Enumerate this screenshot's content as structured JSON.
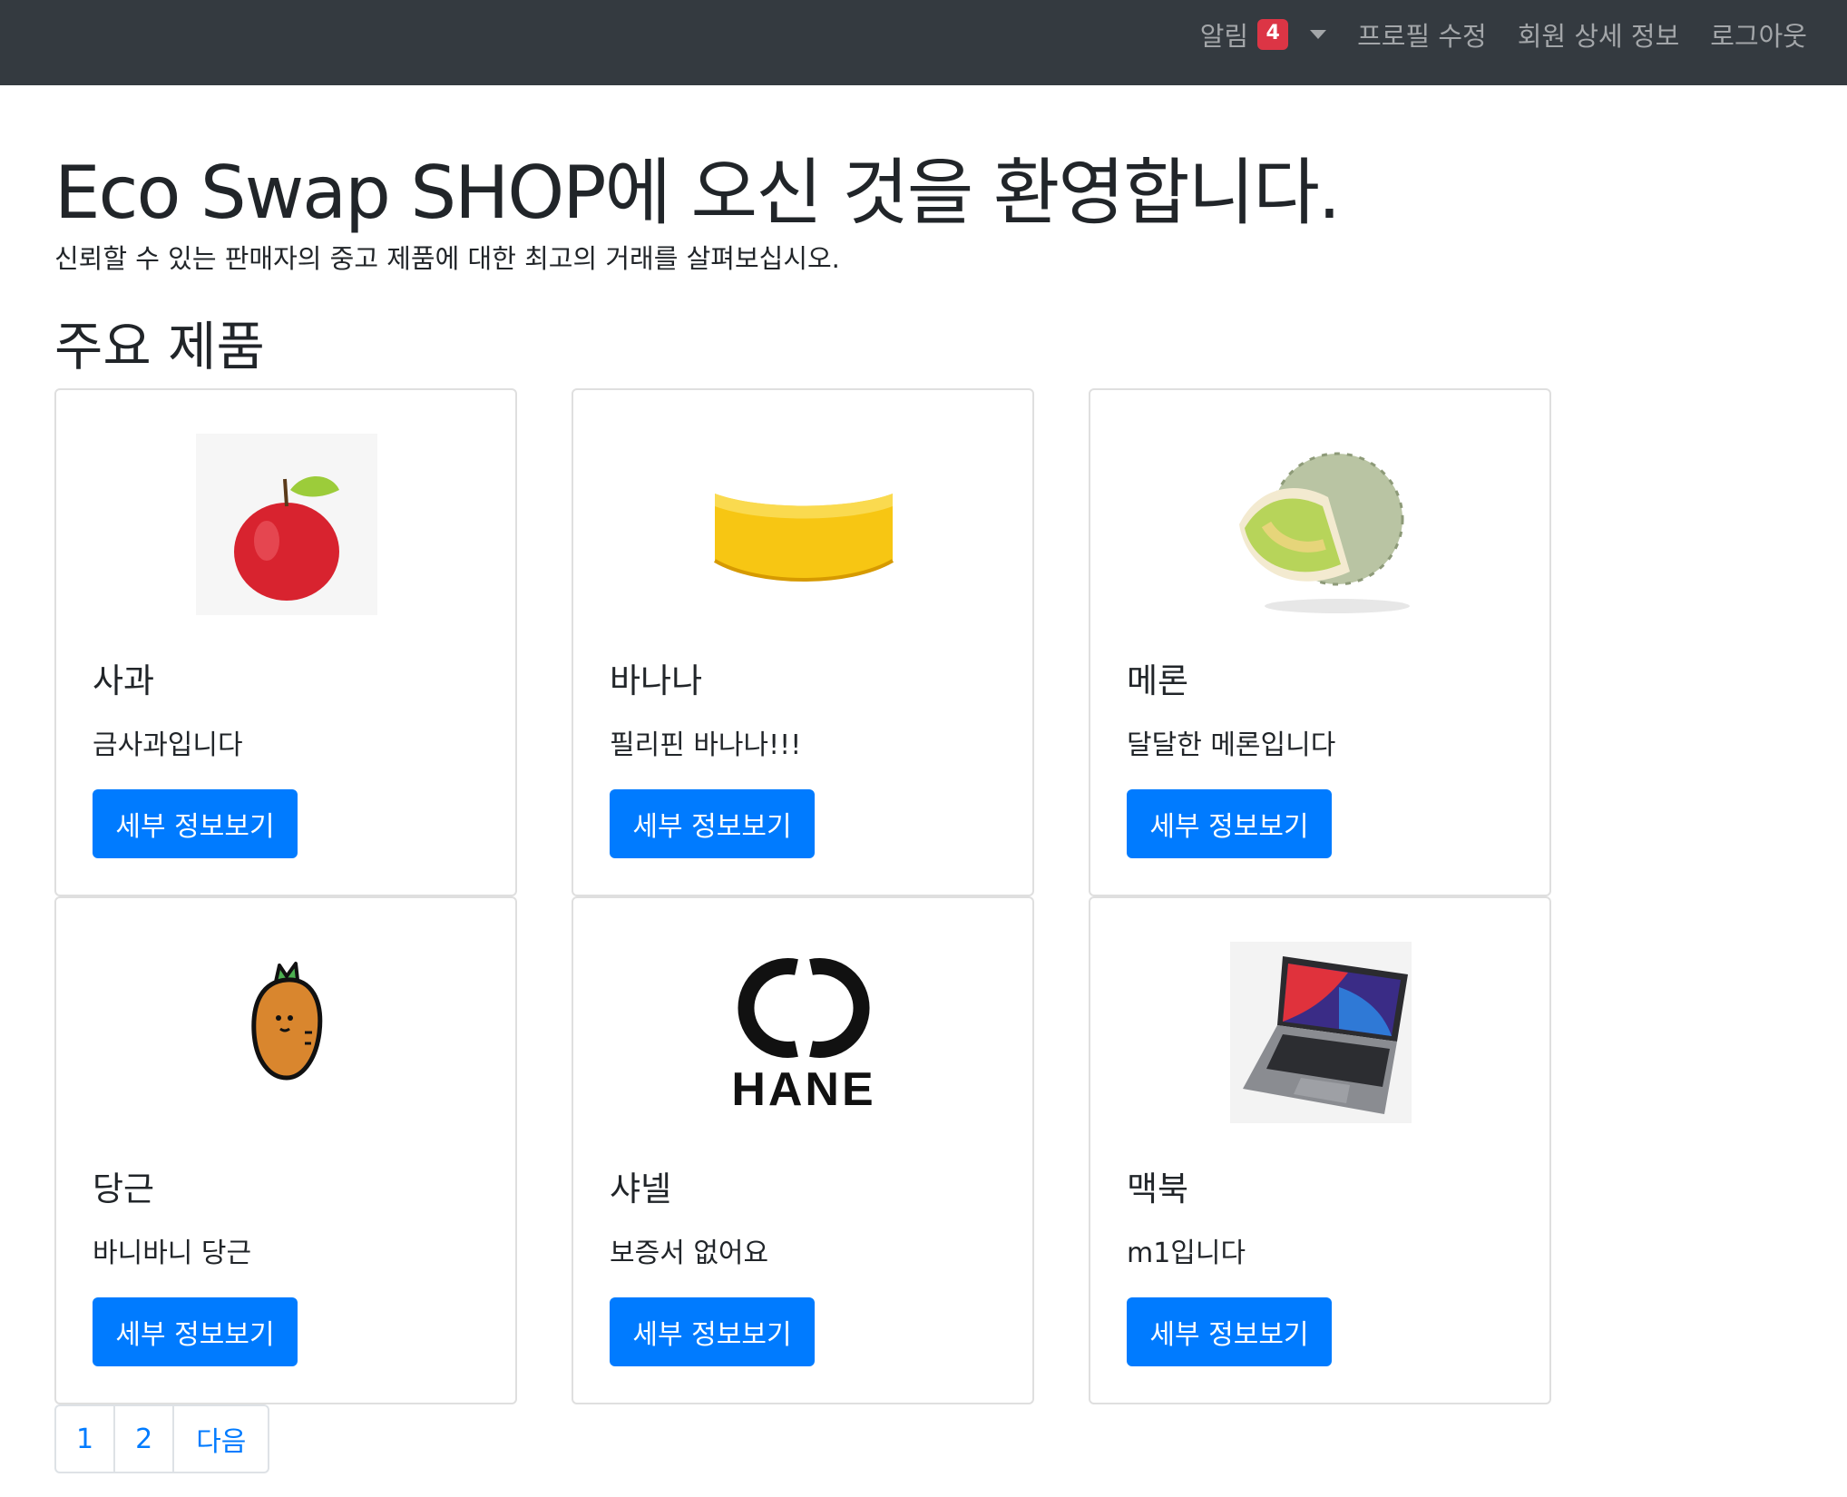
{
  "nav": {
    "alerts_label": "알림",
    "alerts_count": "4",
    "profile_edit": "프로필 수정",
    "member_details": "회원 상세 정보",
    "logout": "로그아웃"
  },
  "hero": {
    "title": "Eco Swap SHOP에 오신 것을 환영합니다.",
    "subtitle": "신뢰할 수 있는 판매자의 중고 제품에 대한 최고의 거래를 살펴보십시오."
  },
  "section": {
    "title": "주요 제품"
  },
  "products": [
    {
      "name": "사과",
      "description": "금사과입니다",
      "button": "세부 정보보기",
      "image_icon": "apple-icon"
    },
    {
      "name": "바나나",
      "description": "필리핀 바나나!!!",
      "button": "세부 정보보기",
      "image_icon": "banana-icon"
    },
    {
      "name": "메론",
      "description": "달달한 메론입니다",
      "button": "세부 정보보기",
      "image_icon": "melon-icon"
    },
    {
      "name": "당근",
      "description": "바니바니 당근",
      "button": "세부 정보보기",
      "image_icon": "carrot-icon"
    },
    {
      "name": "샤넬",
      "description": "보증서 없어요",
      "button": "세부 정보보기",
      "image_icon": "chanel-logo",
      "logo_text": "HANE"
    },
    {
      "name": "맥북",
      "description": "m1입니다",
      "button": "세부 정보보기",
      "image_icon": "laptop-icon"
    }
  ],
  "pagination": {
    "page1": "1",
    "page2": "2",
    "next": "다음"
  },
  "colors": {
    "navbar": "#343a40",
    "primary": "#007bff",
    "badge": "#dc3545"
  }
}
